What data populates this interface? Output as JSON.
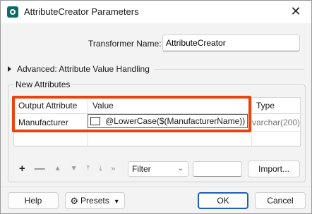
{
  "window": {
    "title": "AttributeCreator Parameters"
  },
  "transformer": {
    "label": "Transformer Name:",
    "value": "AttributeCreator"
  },
  "advanced": {
    "label": "Advanced: Attribute Value Handling"
  },
  "new_attributes": {
    "label": "New Attributes",
    "columns": [
      "Output Attribute",
      "Value",
      "Type"
    ],
    "rows": [
      {
        "output_attribute": "Manufacturer",
        "value": "@LowerCase($(ManufacturerName))",
        "type": "varchar(200)"
      }
    ]
  },
  "toolbar": {
    "filter_value": "Filter",
    "import_label": "Import..."
  },
  "footer": {
    "help_label": "Help",
    "presets_label": "Presets",
    "ok_label": "OK",
    "cancel_label": "Cancel"
  },
  "colors": {
    "highlight": "#e8440e",
    "primary_border": "#1f5fbf"
  }
}
